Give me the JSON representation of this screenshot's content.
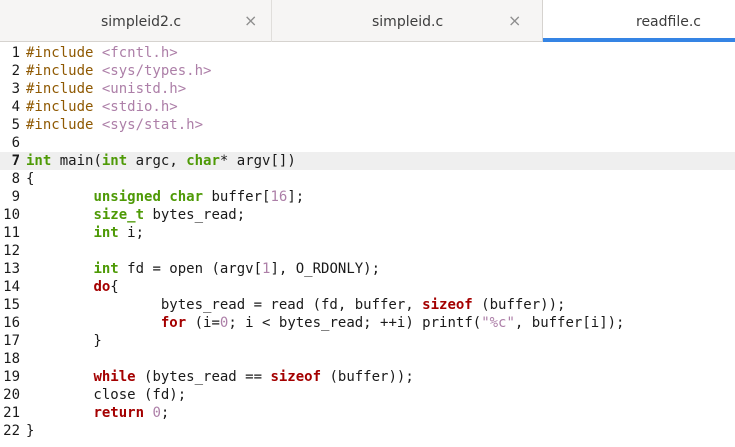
{
  "tabs": [
    {
      "label": "simpleid2.c",
      "close_icon": "×"
    },
    {
      "label": "simpleid.c",
      "close_icon": "×"
    },
    {
      "label": "readfile.c"
    }
  ],
  "editor": {
    "current_line": 7,
    "lines": [
      {
        "n": "1",
        "tokens": [
          {
            "t": "#include ",
            "c": "pp"
          },
          {
            "t": "<fcntl.h>",
            "c": "str"
          }
        ]
      },
      {
        "n": "2",
        "tokens": [
          {
            "t": "#include ",
            "c": "pp"
          },
          {
            "t": "<sys/types.h>",
            "c": "str"
          }
        ]
      },
      {
        "n": "3",
        "tokens": [
          {
            "t": "#include ",
            "c": "pp"
          },
          {
            "t": "<unistd.h>",
            "c": "str"
          }
        ]
      },
      {
        "n": "4",
        "tokens": [
          {
            "t": "#include ",
            "c": "pp"
          },
          {
            "t": "<stdio.h>",
            "c": "str"
          }
        ]
      },
      {
        "n": "5",
        "tokens": [
          {
            "t": "#include ",
            "c": "pp"
          },
          {
            "t": "<sys/stat.h>",
            "c": "str"
          }
        ]
      },
      {
        "n": "6",
        "tokens": []
      },
      {
        "n": "7",
        "tokens": [
          {
            "t": "int",
            "c": "kw"
          },
          {
            "t": " main("
          },
          {
            "t": "int",
            "c": "kw"
          },
          {
            "t": " argc, "
          },
          {
            "t": "char",
            "c": "kw"
          },
          {
            "t": "* argv[])"
          }
        ]
      },
      {
        "n": "8",
        "tokens": [
          {
            "t": "{"
          }
        ]
      },
      {
        "n": "9",
        "tokens": [
          {
            "t": "        "
          },
          {
            "t": "unsigned",
            "c": "kw"
          },
          {
            "t": " "
          },
          {
            "t": "char",
            "c": "kw"
          },
          {
            "t": " buffer["
          },
          {
            "t": "16",
            "c": "num"
          },
          {
            "t": "];"
          }
        ]
      },
      {
        "n": "10",
        "tokens": [
          {
            "t": "        "
          },
          {
            "t": "size_t",
            "c": "kw"
          },
          {
            "t": " bytes_read;"
          }
        ]
      },
      {
        "n": "11",
        "tokens": [
          {
            "t": "        "
          },
          {
            "t": "int",
            "c": "kw"
          },
          {
            "t": " i;"
          }
        ]
      },
      {
        "n": "12",
        "tokens": []
      },
      {
        "n": "13",
        "tokens": [
          {
            "t": "        "
          },
          {
            "t": "int",
            "c": "kw"
          },
          {
            "t": " fd = open (argv["
          },
          {
            "t": "1",
            "c": "num"
          },
          {
            "t": "], O_RDONLY);"
          }
        ]
      },
      {
        "n": "14",
        "tokens": [
          {
            "t": "        "
          },
          {
            "t": "do",
            "c": "ctl"
          },
          {
            "t": "{"
          }
        ]
      },
      {
        "n": "15",
        "tokens": [
          {
            "t": "                bytes_read = read (fd, buffer, "
          },
          {
            "t": "sizeof",
            "c": "ctl"
          },
          {
            "t": " (buffer));"
          }
        ]
      },
      {
        "n": "16",
        "tokens": [
          {
            "t": "                "
          },
          {
            "t": "for",
            "c": "ctl"
          },
          {
            "t": " (i="
          },
          {
            "t": "0",
            "c": "num"
          },
          {
            "t": "; i < bytes_read; ++i) printf("
          },
          {
            "t": "\"%c\"",
            "c": "str"
          },
          {
            "t": ", buffer[i]);"
          }
        ]
      },
      {
        "n": "17",
        "tokens": [
          {
            "t": "        }"
          }
        ]
      },
      {
        "n": "18",
        "tokens": []
      },
      {
        "n": "19",
        "tokens": [
          {
            "t": "        "
          },
          {
            "t": "while",
            "c": "ctl"
          },
          {
            "t": " (bytes_read == "
          },
          {
            "t": "sizeof",
            "c": "ctl"
          },
          {
            "t": " (buffer));"
          }
        ]
      },
      {
        "n": "20",
        "tokens": [
          {
            "t": "        close (fd);"
          }
        ]
      },
      {
        "n": "21",
        "tokens": [
          {
            "t": "        "
          },
          {
            "t": "return",
            "c": "ctl"
          },
          {
            "t": " "
          },
          {
            "t": "0",
            "c": "num"
          },
          {
            "t": ";"
          }
        ]
      },
      {
        "n": "22",
        "tokens": [
          {
            "t": "}"
          }
        ]
      }
    ]
  }
}
